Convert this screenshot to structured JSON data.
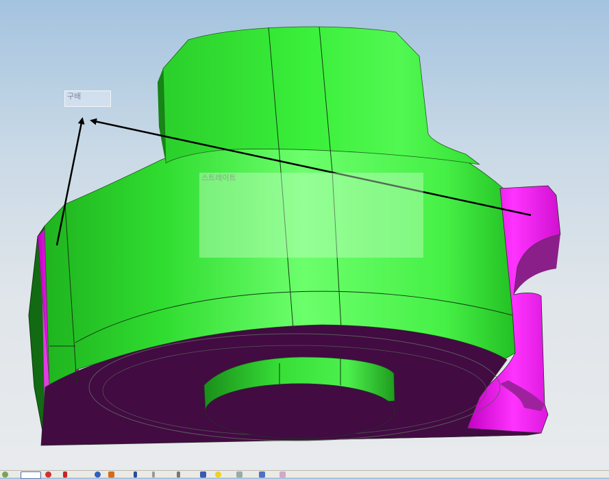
{
  "viewport": {
    "labels": {
      "gradient": "구배",
      "straight": "스트레이트"
    },
    "colors": {
      "background_top": "#a4c3df",
      "background_bottom": "#e9ebed",
      "green_face": "#39e639",
      "magenta_face": "#ff22ff",
      "purple_face": "#420b42",
      "arrow": "#000000"
    }
  },
  "toolbar": {
    "icons": [
      "select-icon",
      "sketch-icon",
      "circle-icon",
      "search-icon",
      "paint-icon",
      "arrow-icon",
      "line-icon",
      "point-icon",
      "text-icon",
      "save-icon",
      "help-icon",
      "shape-icon",
      "fill-icon",
      "eraser-icon"
    ]
  }
}
